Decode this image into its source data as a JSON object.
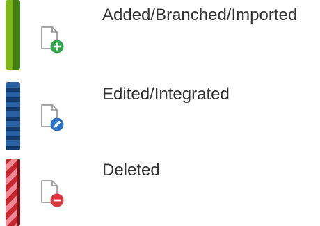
{
  "legend": {
    "items": [
      {
        "label": "Added/Branched/Imported",
        "icon": "file-add-icon",
        "bar_color": "#7fb51a",
        "bar_style": "solid green",
        "badge_color": "#2ea84a"
      },
      {
        "label": "Edited/Integrated",
        "icon": "file-edit-icon",
        "bar_color": "#2a5fa3",
        "bar_style": "blue horizontal stripes",
        "badge_color": "#2c73c8"
      },
      {
        "label": "Deleted",
        "icon": "file-delete-icon",
        "bar_color": "#c6262e",
        "bar_style": "red diagonal stripes",
        "badge_color": "#d9363e"
      }
    ]
  }
}
